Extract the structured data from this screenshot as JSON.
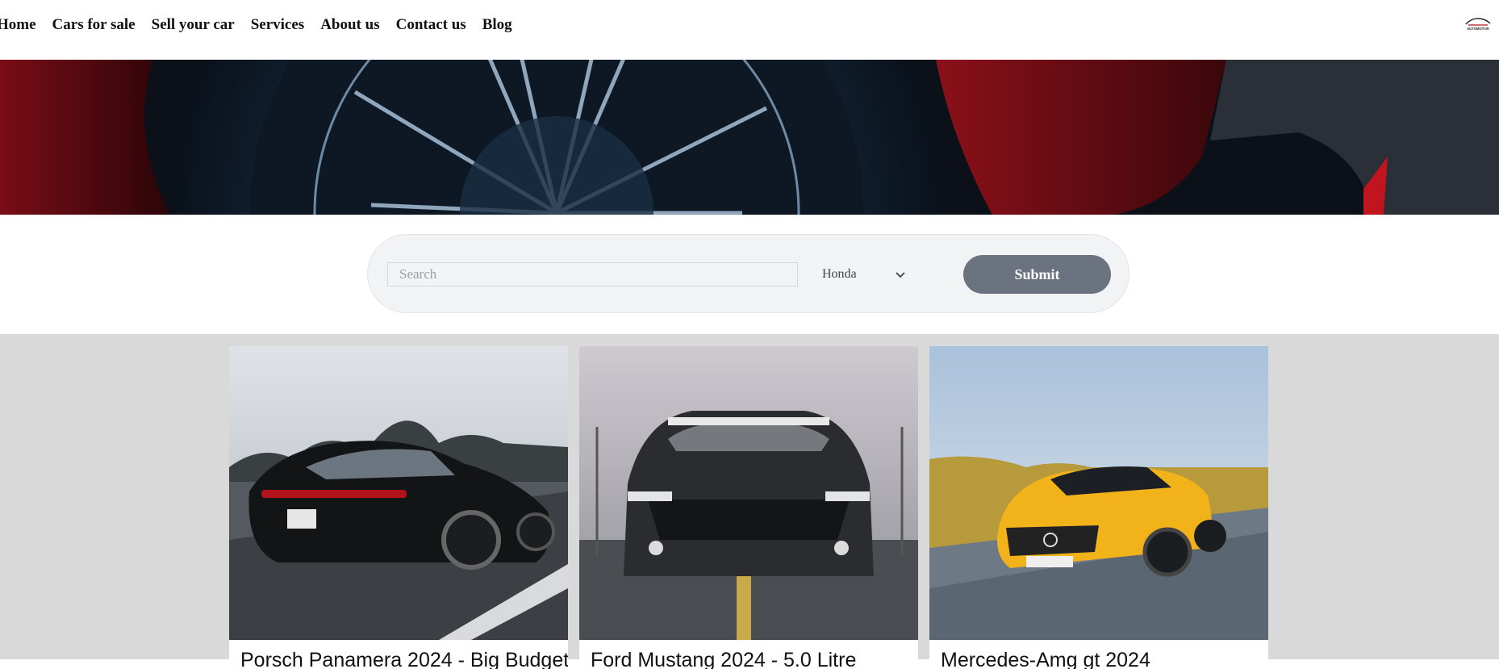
{
  "nav": {
    "links": [
      "Home",
      "Cars for sale",
      "Sell your car",
      "Services",
      "About us",
      "Contact us",
      "Blog"
    ],
    "logo_text": "AUTOMOTIVE"
  },
  "search": {
    "placeholder": "Search",
    "select_value": "Honda",
    "submit_label": "Submit"
  },
  "listings": [
    {
      "title": "Porsch Panamera 2024 - Big Budget"
    },
    {
      "title": "Ford Mustang 2024 - 5.0 Litre"
    },
    {
      "title": "Mercedes-Amg gt 2024"
    }
  ],
  "colors": {
    "submit_bg": "#6c7380",
    "listings_bg": "#d9d9d9",
    "search_bg": "#f2f3f5"
  }
}
